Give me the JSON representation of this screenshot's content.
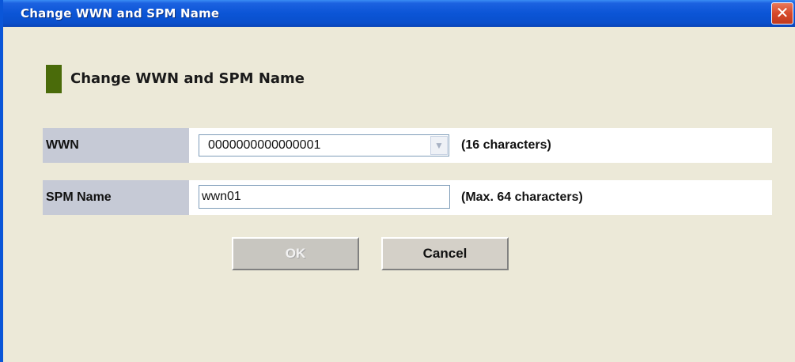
{
  "window": {
    "title": "Change WWN and SPM Name",
    "close_glyph": "✕"
  },
  "section": {
    "title": "Change WWN and SPM Name",
    "marker_color": "#4a6b0a"
  },
  "form": {
    "wwn": {
      "label": "WWN",
      "selected_value": "0000000000000001",
      "arrow_glyph": "▼",
      "hint": "(16 characters)"
    },
    "spm_name": {
      "label": "SPM Name",
      "value": "wwn01",
      "hint": "(Max. 64 characters)"
    }
  },
  "buttons": {
    "ok": {
      "label": "OK",
      "enabled": false
    },
    "cancel": {
      "label": "Cancel",
      "enabled": true
    }
  },
  "icons": {
    "close": "close-icon",
    "dropdown": "chevron-down-icon"
  },
  "colors": {
    "titlebar": "#0b55d6",
    "window_bg": "#ece9d8",
    "label_bg": "#c6cad6",
    "close_button": "#d6492b"
  }
}
